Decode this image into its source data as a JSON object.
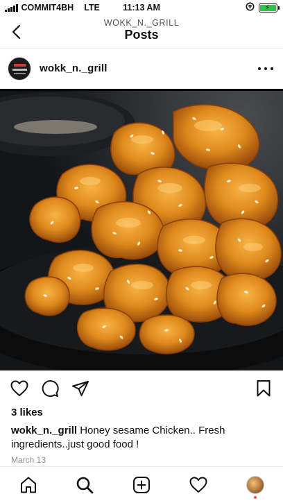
{
  "status_bar": {
    "carrier": "COMMIT4BH",
    "network": "LTE",
    "time": "11:13 AM"
  },
  "header": {
    "account": "WOKK_N._GRILL",
    "title": "Posts"
  },
  "post": {
    "username": "wokk_n._grill",
    "image_alt": "Honey sesame chicken",
    "likes": "3 likes",
    "caption_username": "wokk_n._grill",
    "caption_text": "Honey sesame Chicken.. Fresh ingredients..just good food !",
    "date": "March 13"
  },
  "icons": {
    "back": "chevron-left-icon",
    "more": "more-horizontal-icon",
    "like": "heart-icon",
    "comment": "comment-icon",
    "share": "send-icon",
    "save": "bookmark-icon",
    "home": "home-icon",
    "search": "search-icon",
    "new_post": "plus-square-icon",
    "activity": "heart-icon",
    "profile": "avatar"
  },
  "colors": {
    "battery": "#33c24d",
    "notification_dot": "#ed4956",
    "date_text": "#8e8e8e"
  }
}
